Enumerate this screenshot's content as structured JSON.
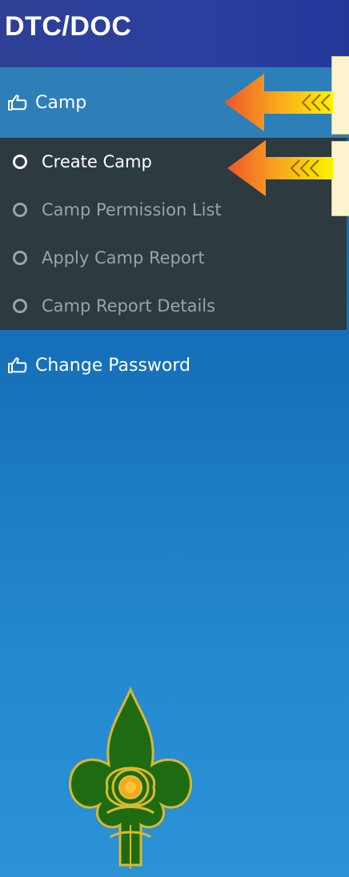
{
  "header": {
    "title": "DTC/DOC"
  },
  "menu": {
    "camp_label": "Camp",
    "submenu": [
      {
        "label": "Create Camp",
        "active": true
      },
      {
        "label": "Camp Permission List",
        "active": false
      },
      {
        "label": "Apply Camp Report",
        "active": false
      },
      {
        "label": "Camp Report Details",
        "active": false
      }
    ],
    "change_password_label": "Change Password"
  },
  "colors": {
    "header_bg": "#2e3f95",
    "camp_row_bg": "#2d7fb8",
    "submenu_bg": "#2d3a40",
    "sidebar_bg": "#1670b9",
    "active_text": "#ffffff",
    "inactive_text": "#9aa4a8",
    "callout_bg": "#fdf3cf",
    "emblem_green": "#1f6b12",
    "emblem_gold": "#d9b92e"
  },
  "icons": {
    "menu_icon": "pointing-hand-icon",
    "submenu_icon": "circle-outline-icon",
    "annotation": "highlight-arrow-icon"
  }
}
